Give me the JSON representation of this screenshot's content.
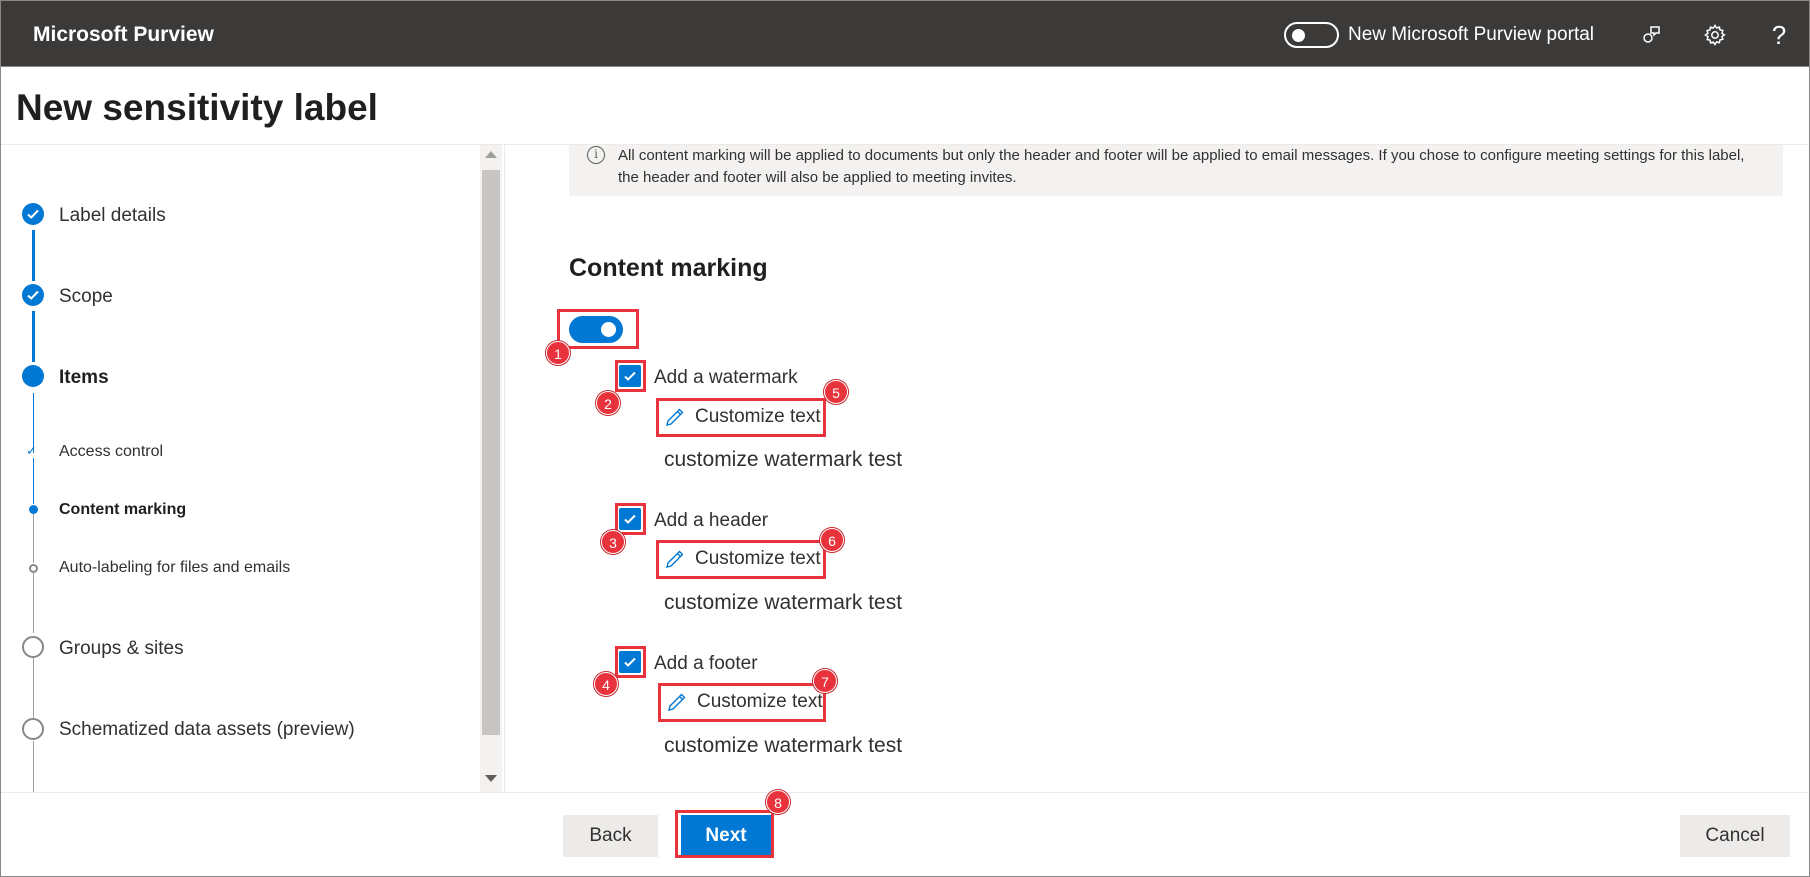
{
  "topbar": {
    "brand": "Microsoft Purview",
    "portal_toggle_label": "New Microsoft Purview portal",
    "portal_toggle_on": false,
    "icons": [
      "community-icon",
      "gear-icon",
      "help-icon"
    ],
    "help_glyph": "?"
  },
  "page": {
    "title": "New sensitivity label"
  },
  "nav": {
    "steps": [
      {
        "label": "Label details",
        "state": "done"
      },
      {
        "label": "Scope",
        "state": "done"
      },
      {
        "label": "Items",
        "state": "current"
      },
      {
        "label": "Groups & sites",
        "state": "todo"
      },
      {
        "label": "Schematized data assets (preview)",
        "state": "todo"
      }
    ],
    "substeps": [
      {
        "label": "Access control",
        "state": "done"
      },
      {
        "label": "Content marking",
        "state": "current"
      },
      {
        "label": "Auto-labeling for files and emails",
        "state": "todo"
      }
    ],
    "check_glyph": "✓"
  },
  "info": {
    "icon_glyph": "i",
    "text": "All content marking will be applied to documents but only the header and footer will be applied to email messages. If you chose to configure meeting settings for this label, the header and footer will also be applied to meeting invites."
  },
  "content_marking": {
    "title": "Content marking",
    "enabled": true,
    "options": [
      {
        "label": "Add a watermark",
        "checked": true,
        "customize_label": "Customize text",
        "value": "customize watermark test"
      },
      {
        "label": "Add a header",
        "checked": true,
        "customize_label": "Customize text",
        "value": "customize watermark test"
      },
      {
        "label": "Add a footer",
        "checked": true,
        "customize_label": "Customize text",
        "value": "customize watermark test"
      }
    ]
  },
  "annotations": [
    "1",
    "2",
    "3",
    "4",
    "5",
    "6",
    "7",
    "8"
  ],
  "footer": {
    "back_label": "Back",
    "next_label": "Next",
    "cancel_label": "Cancel"
  },
  "colors": {
    "accent": "#0078d4",
    "topbar": "#3b3a39",
    "highlight": "#e8323c"
  }
}
